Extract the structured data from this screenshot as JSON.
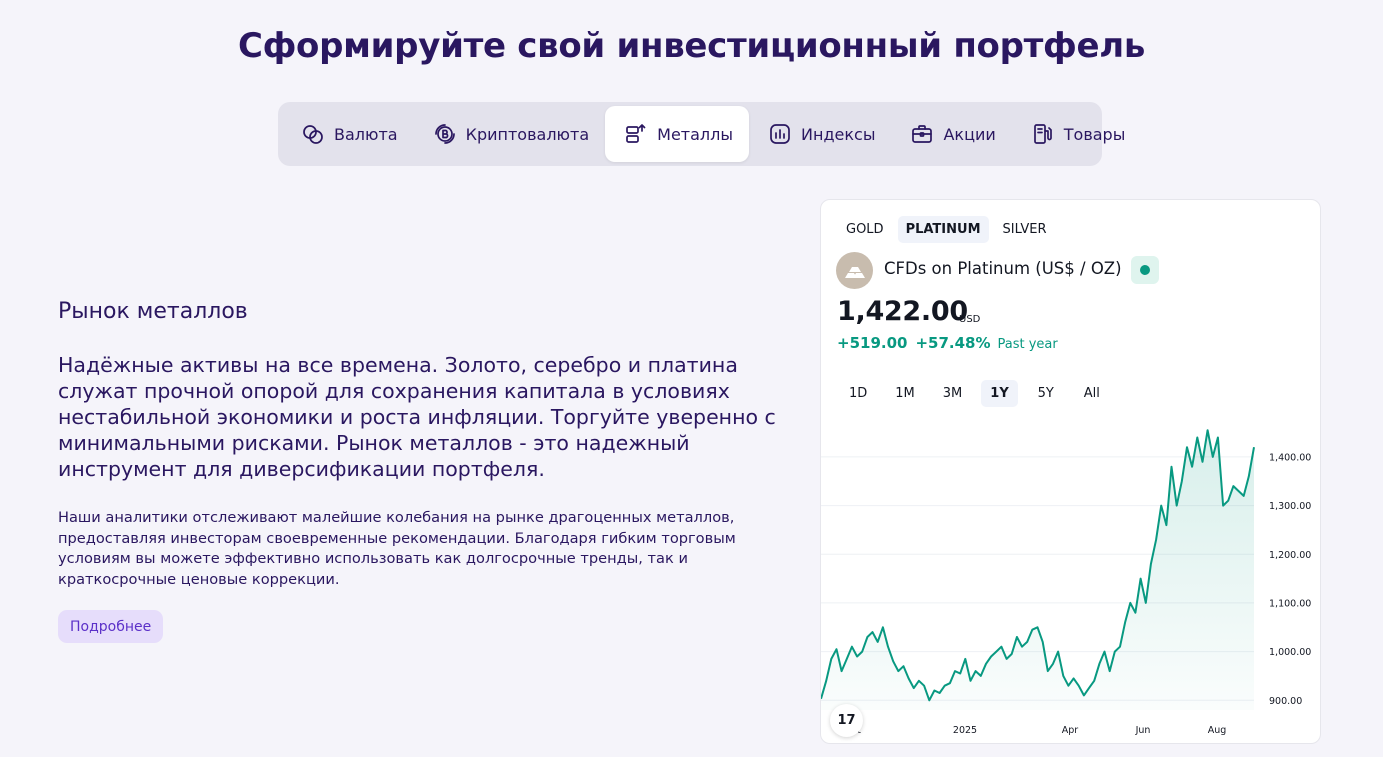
{
  "title": "Сформируйте свой инвестиционный портфель",
  "tabs": [
    {
      "label": "Валюта",
      "icon": "currency-icon"
    },
    {
      "label": "Криптовалюта",
      "icon": "crypto-icon"
    },
    {
      "label": "Металлы",
      "icon": "metals-icon",
      "active": true
    },
    {
      "label": "Индексы",
      "icon": "indices-icon"
    },
    {
      "label": "Акции",
      "icon": "stocks-icon"
    },
    {
      "label": "Товары",
      "icon": "commodities-icon"
    }
  ],
  "section": {
    "heading": "Рынок металлов",
    "lead": "Надёжные активы на все времена. Золото, серебро и платина служат прочной опорой для сохранения капитала в условиях нестабильной экономики и роста инфляции. Торгуйте уверенно с минимальными рисками. Рынок металлов - это надежный инструмент для диверсификации портфеля.",
    "body": "Наши аналитики отслеживают малейшие колебания на рынке драгоценных металлов, предоставляя инвесторам своевременные рекомендации. Благодаря гибким торговым условиям вы можете эффективно использовать как долгосрочные тренды, так и краткосрочные ценовые коррекции.",
    "button": "Подробнее"
  },
  "widget": {
    "metal_tabs": [
      "GOLD",
      "PLATINUM",
      "SILVER"
    ],
    "active_metal": "PLATINUM",
    "symbol_name": "CFDs on Platinum (US$ / OZ)",
    "price": "1,422.00",
    "currency": "USD",
    "change_abs": "+519.00",
    "change_pct": "+57.48%",
    "period_label": "Past year",
    "ranges": [
      "1D",
      "1M",
      "3M",
      "1Y",
      "5Y",
      "All"
    ],
    "active_range": "1Y",
    "logo_text": "17",
    "colors": {
      "line": "#089981",
      "up": "#089981",
      "text": "#131722",
      "axis": "#131722"
    }
  },
  "chart_data": {
    "type": "area",
    "series": [
      {
        "values": [
          903,
          940,
          985,
          1005,
          960,
          985,
          1010,
          990,
          1000,
          1030,
          1040,
          1020,
          1050,
          1010,
          980,
          960,
          970,
          945,
          925,
          940,
          930,
          900,
          920,
          915,
          930,
          935,
          960,
          955,
          985,
          940,
          960,
          950,
          975,
          990,
          1000,
          1010,
          985,
          995,
          1030,
          1010,
          1020,
          1045,
          1050,
          1020,
          960,
          975,
          1000,
          950,
          930,
          945,
          930,
          910,
          925,
          940,
          975,
          1000,
          960,
          1000,
          1010,
          1060,
          1100,
          1080,
          1150,
          1100,
          1180,
          1230,
          1300,
          1260,
          1380,
          1300,
          1350,
          1420,
          1380,
          1440,
          1390,
          1455,
          1400,
          1440,
          1300,
          1310,
          1340,
          1330,
          1320,
          1360,
          1420
        ]
      }
    ],
    "x_tick_labels": [
      "t",
      "2025",
      "Apr",
      "Jun",
      "Aug"
    ],
    "y_ticks": [
      900,
      1000,
      1100,
      1200,
      1300,
      1400
    ],
    "y_tick_labels": [
      "900.00",
      "1,000.00",
      "1,100.00",
      "1,200.00",
      "1,300.00",
      "1,400.00"
    ],
    "ylim": [
      880,
      1480
    ],
    "grid": true
  }
}
